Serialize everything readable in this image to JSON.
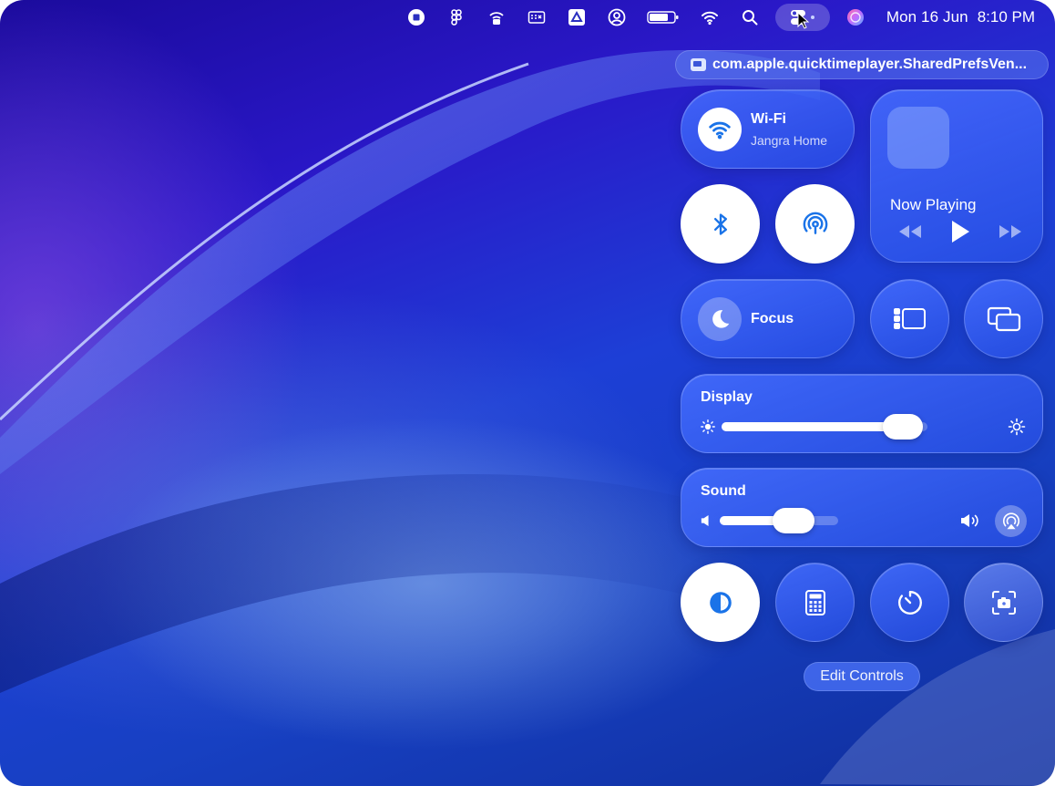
{
  "menubar": {
    "icons": [
      "stop-record-icon",
      "figma-icon",
      "hotspot-icon",
      "keyboard-icon",
      "drive-icon",
      "account-icon",
      "battery-icon",
      "wifi-icon",
      "search-icon",
      "control-center-icon",
      "siri-icon"
    ],
    "date": "Mon 16 Jun",
    "time": "8:10 PM"
  },
  "bundle_banner": {
    "text": "com.apple.quicktimeplayer.SharedPrefsVen..."
  },
  "control_center": {
    "wifi": {
      "title": "Wi-Fi",
      "network": "Jangra Home",
      "icon": "wifi-icon"
    },
    "bluetooth": {
      "icon": "bluetooth-icon"
    },
    "airdrop": {
      "icon": "airdrop-icon"
    },
    "now_playing": {
      "title": "Now Playing",
      "controls": [
        "rewind-icon",
        "play-icon",
        "fast-forward-icon"
      ]
    },
    "focus": {
      "title": "Focus",
      "icon": "moon-icon"
    },
    "stage_manager": {
      "icon": "stage-manager-icon"
    },
    "screen_mirroring": {
      "icon": "screen-mirroring-icon"
    },
    "display": {
      "title": "Display",
      "level": 0.88
    },
    "sound": {
      "title": "Sound",
      "level": 0.62
    },
    "bottom_row": [
      "dark-mode-icon",
      "calculator-icon",
      "timer-icon",
      "screenshot-icon"
    ],
    "edit_label": "Edit Controls"
  },
  "colors": {
    "accent": "#1a73e8",
    "tile": "#3f6cff"
  }
}
